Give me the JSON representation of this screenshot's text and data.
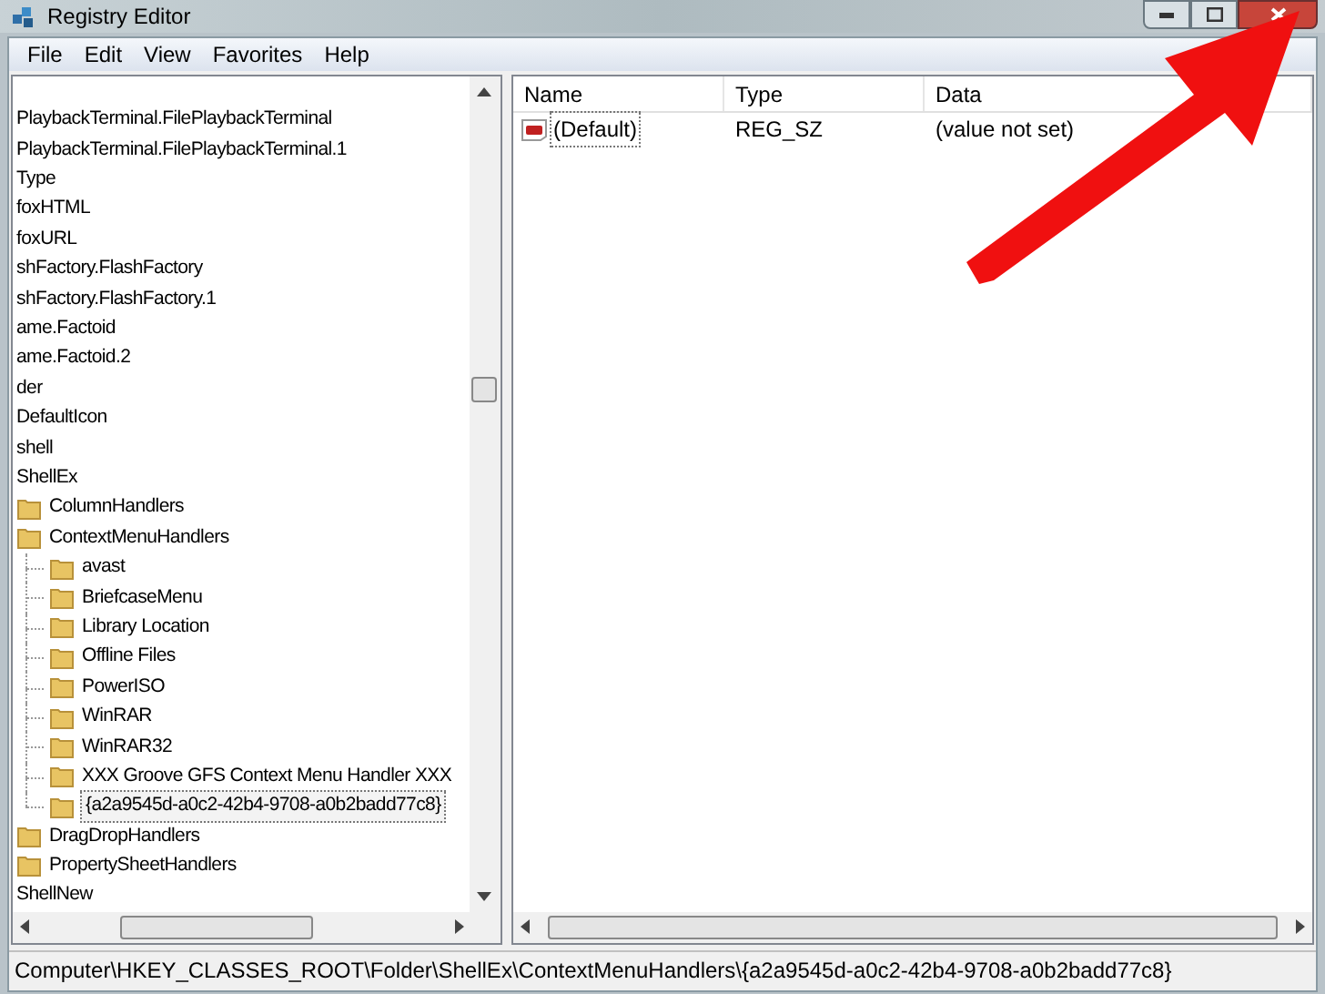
{
  "window": {
    "title": "Registry Editor"
  },
  "menu": [
    "File",
    "Edit",
    "View",
    "Favorites",
    "Help"
  ],
  "tree": [
    {
      "kind": "clipped",
      "label": "PlaybackTerminal.FilePlaybackTerminal",
      "selected": false
    },
    {
      "kind": "clipped",
      "label": "PlaybackTerminal.FilePlaybackTerminal.1",
      "selected": false
    },
    {
      "kind": "clipped",
      "label": "Type",
      "selected": false
    },
    {
      "kind": "clipped",
      "label": "foxHTML",
      "selected": false
    },
    {
      "kind": "clipped",
      "label": "foxURL",
      "selected": false
    },
    {
      "kind": "clipped",
      "label": "shFactory.FlashFactory",
      "selected": false
    },
    {
      "kind": "clipped",
      "label": "shFactory.FlashFactory.1",
      "selected": false
    },
    {
      "kind": "clipped",
      "label": "ame.Factoid",
      "selected": false
    },
    {
      "kind": "clipped",
      "label": "ame.Factoid.2",
      "selected": false
    },
    {
      "kind": "clipped",
      "label": "der",
      "selected": false
    },
    {
      "kind": "clipped",
      "label": "DefaultIcon",
      "selected": false
    },
    {
      "kind": "clipped",
      "label": "shell",
      "selected": false
    },
    {
      "kind": "clipped",
      "label": "ShellEx",
      "selected": false
    },
    {
      "kind": "folder",
      "label": "ColumnHandlers",
      "selected": false
    },
    {
      "kind": "folder",
      "label": "ContextMenuHandlers",
      "selected": false,
      "children": [
        {
          "kind": "folder",
          "label": "avast",
          "selected": false
        },
        {
          "kind": "folder",
          "label": "BriefcaseMenu",
          "selected": false
        },
        {
          "kind": "folder",
          "label": "Library Location",
          "selected": false
        },
        {
          "kind": "folder",
          "label": "Offline Files",
          "selected": false
        },
        {
          "kind": "folder",
          "label": "PowerISO",
          "selected": false
        },
        {
          "kind": "folder",
          "label": "WinRAR",
          "selected": false
        },
        {
          "kind": "folder",
          "label": "WinRAR32",
          "selected": false
        },
        {
          "kind": "folder",
          "label": "XXX Groove GFS Context Menu Handler XXX",
          "selected": false
        },
        {
          "kind": "folder",
          "label": "{a2a9545d-a0c2-42b4-9708-a0b2badd77c8}",
          "selected": true
        }
      ]
    },
    {
      "kind": "folder",
      "label": "DragDropHandlers",
      "selected": false
    },
    {
      "kind": "folder",
      "label": "PropertySheetHandlers",
      "selected": false
    },
    {
      "kind": "clipped",
      "label": "ShellNew",
      "selected": false
    }
  ],
  "values": {
    "columns": [
      "Name",
      "Type",
      "Data"
    ],
    "rows": [
      {
        "name": "(Default)",
        "type": "REG_SZ",
        "data": "(value not set)"
      }
    ]
  },
  "status_bar": "Computer\\HKEY_CLASSES_ROOT\\Folder\\ShellEx\\ContextMenuHandlers\\{a2a9545d-a0c2-42b4-9708-a0b2badd77c8}"
}
